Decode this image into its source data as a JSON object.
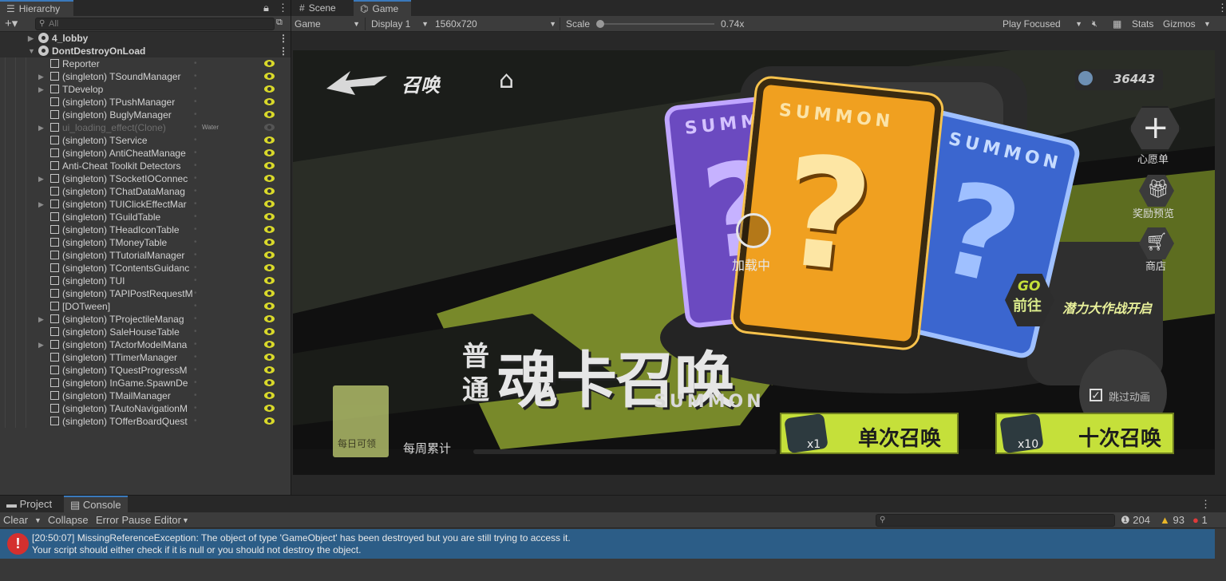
{
  "hierarchy": {
    "tab_label": "Hierarchy",
    "search_placeholder": "All",
    "scene_lobby": "4_lobby",
    "scene_ddol": "DontDestroyOnLoad",
    "items": [
      {
        "label": "Reporter",
        "expandable": false,
        "active": true
      },
      {
        "label": "(singleton) TSoundManager",
        "expandable": true,
        "active": true
      },
      {
        "label": "TDevelop",
        "expandable": true,
        "active": true
      },
      {
        "label": "(singleton) TPushManager",
        "expandable": false,
        "active": true
      },
      {
        "label": "(singleton) BuglyManager",
        "expandable": false,
        "active": true
      },
      {
        "label": "ui_loading_effect(Clone)",
        "expandable": true,
        "active": false,
        "tag": "Water"
      },
      {
        "label": "(singleton) TService",
        "expandable": false,
        "active": true
      },
      {
        "label": "(singleton) AntiCheatManage",
        "expandable": false,
        "active": true
      },
      {
        "label": "Anti-Cheat Toolkit Detectors",
        "expandable": false,
        "active": true
      },
      {
        "label": "(singleton) TSocketIOConnec",
        "expandable": true,
        "active": true
      },
      {
        "label": "(singleton) TChatDataManag",
        "expandable": false,
        "active": true
      },
      {
        "label": "(singleton) TUIClickEffectMar",
        "expandable": true,
        "active": true
      },
      {
        "label": "(singleton) TGuildTable",
        "expandable": false,
        "active": true
      },
      {
        "label": "(singleton) THeadIconTable",
        "expandable": false,
        "active": true
      },
      {
        "label": "(singleton) TMoneyTable",
        "expandable": false,
        "active": true
      },
      {
        "label": "(singleton) TTutorialManager",
        "expandable": false,
        "active": true
      },
      {
        "label": "(singleton) TContentsGuidanc",
        "expandable": false,
        "active": true
      },
      {
        "label": "(singleton) TUI",
        "expandable": false,
        "active": true
      },
      {
        "label": "(singleton) TAPIPostRequestM",
        "expandable": false,
        "active": true
      },
      {
        "label": "[DOTween]",
        "expandable": false,
        "active": true
      },
      {
        "label": "(singleton) TProjectileManag",
        "expandable": true,
        "active": true
      },
      {
        "label": "(singleton) SaleHouseTable",
        "expandable": false,
        "active": true
      },
      {
        "label": "(singleton) TActorModelMana",
        "expandable": true,
        "active": true
      },
      {
        "label": "(singleton) TTimerManager",
        "expandable": false,
        "active": true
      },
      {
        "label": "(singleton) TQuestProgressM",
        "expandable": false,
        "active": true
      },
      {
        "label": "(singleton) InGame.SpawnDe",
        "expandable": false,
        "active": true
      },
      {
        "label": "(singleton) TMailManager",
        "expandable": false,
        "active": true
      },
      {
        "label": "(singleton) TAutoNavigationM",
        "expandable": false,
        "active": true
      },
      {
        "label": "(singleton) TOfferBoardQuest",
        "expandable": false,
        "active": true
      }
    ]
  },
  "view_tabs": {
    "scene": "Scene",
    "game": "Game"
  },
  "game_toolbar": {
    "mode": "Game",
    "display": "Display 1",
    "resolution": "1560x720",
    "scale_label": "Scale",
    "scale_value": "0.74x",
    "scale_fraction": 0.0,
    "play_mode": "Play Focused",
    "stats": "Stats",
    "gizmos": "Gizmos"
  },
  "game": {
    "title": "召唤",
    "currency": "36443",
    "wishlist": "心愿单",
    "rewards": "奖励预览",
    "shop": "商店",
    "loading": "加载中",
    "go_top": "GO",
    "go_bottom": "前往",
    "event_banner": "潜力大作战开启",
    "card_text": "SUMMON",
    "title_small_1": "普",
    "title_small_2": "通",
    "title_big": "魂卡召唤",
    "title_sub": "SUMMON",
    "skip_anim": "跳过动画",
    "daily": "每日可领",
    "weekly": "每周累计",
    "single_summon": "单次召唤",
    "single_count": "x1",
    "ten_summon": "十次召唤",
    "ten_count": "x10",
    "colors": {
      "lime": "#c5e03a",
      "orange": "#f0a020",
      "purple": "#7b55c9",
      "blue": "#3f6fd6"
    }
  },
  "console": {
    "tab_project": "Project",
    "tab_console": "Console",
    "clear": "Clear",
    "collapse": "Collapse",
    "error_pause": "Error Pause",
    "editor": "Editor",
    "count_log": "204",
    "count_warn": "93",
    "count_error": "1",
    "log_line1": "[20:50:07] MissingReferenceException: The object of type 'GameObject' has been destroyed but you are still trying to access it.",
    "log_line2": "Your script should either check if it is null or you should not destroy the object."
  }
}
